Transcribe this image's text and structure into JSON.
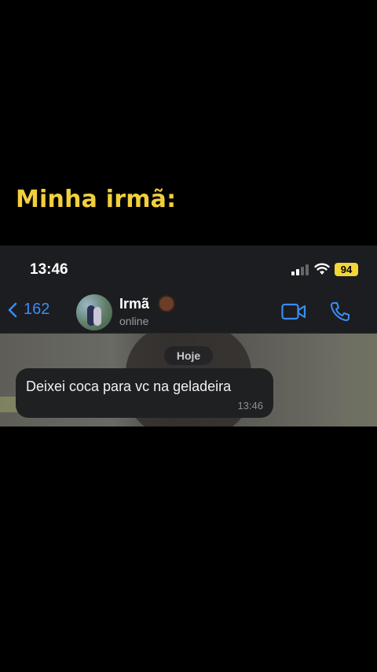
{
  "caption": "Minha irmã:",
  "status_bar": {
    "time": "13:46",
    "battery": "94",
    "signal_icon": "signal-bars-icon",
    "wifi_icon": "wifi-icon"
  },
  "header": {
    "back_count": "162",
    "contact_name": "Irmã",
    "contact_status": "online",
    "emoji": "woman-emoji",
    "actions": [
      "video-call-icon",
      "phone-call-icon"
    ]
  },
  "chat": {
    "date_label": "Hoje",
    "messages": [
      {
        "text": "Deixei coca para vc na geladeira",
        "time": "13:46"
      }
    ]
  },
  "colors": {
    "caption": "#f2cf3c",
    "accent": "#3b8cf2",
    "battery": "#f3d539"
  }
}
